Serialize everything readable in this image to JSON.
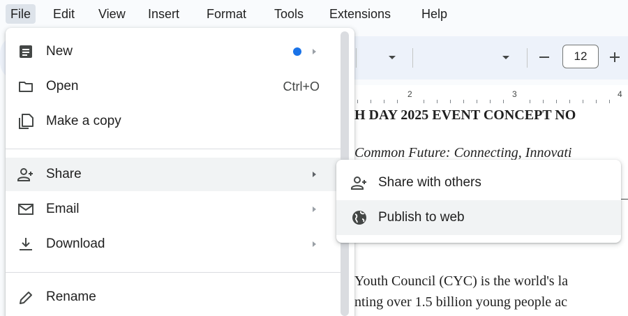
{
  "menubar": {
    "items": [
      "File",
      "Edit",
      "View",
      "Insert",
      "Format",
      "Tools",
      "Extensions",
      "Help"
    ],
    "active": "File"
  },
  "toolbar": {
    "font_size": "12",
    "font_size_minus": "–",
    "font_size_plus": "+"
  },
  "ruler": {
    "numbers": [
      "2",
      "3",
      "4"
    ]
  },
  "document": {
    "title": "H DAY 2025 EVENT CONCEPT NO",
    "subtitle": "Common Future: Connecting, Innovati",
    "paragraph_line1": "Youth Council (CYC) is the world's la",
    "paragraph_line2": "nting over 1.5 billion young people ac"
  },
  "file_menu": {
    "new": {
      "label": "New",
      "icon": "document-icon",
      "indicator_color": "#1a73e8"
    },
    "open": {
      "label": "Open",
      "shortcut": "Ctrl+O",
      "icon": "folder-icon"
    },
    "make_copy": {
      "label": "Make a copy",
      "icon": "copy-icon"
    },
    "share": {
      "label": "Share",
      "icon": "person-add-icon"
    },
    "email": {
      "label": "Email",
      "icon": "mail-icon"
    },
    "download": {
      "label": "Download",
      "icon": "download-icon"
    },
    "rename": {
      "label": "Rename",
      "icon": "pencil-icon"
    }
  },
  "share_submenu": {
    "share_with_others": {
      "label": "Share with others",
      "icon": "person-add-icon"
    },
    "publish_to_web": {
      "label": "Publish to web",
      "icon": "globe-icon"
    }
  },
  "colors": {
    "accent": "#1a73e8",
    "menu_hover": "#f1f3f4",
    "toolbar_bg": "#edf2fa",
    "menubar_active": "#dde3ea"
  }
}
